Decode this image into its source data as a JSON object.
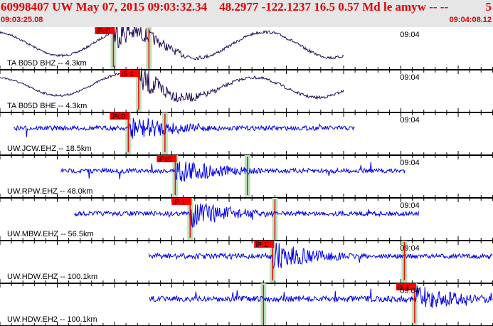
{
  "header": {
    "event": "60998407 UW May 07, 2015 09:03:32.34    48.2977 -122.1237 16.5 0.57 Md le amyw -- --",
    "count": "5",
    "start_time": "09:03:25.08",
    "end_time": "09:04:08.12"
  },
  "window_seconds": 43.04,
  "minute_label": "09:04",
  "minute_time_s": 34.92,
  "colors": {
    "text": "#e00000",
    "pick": "#ff0000",
    "band": "#b9e3bd",
    "trace_broadband": "#220a55",
    "trace_sp": "#0000ee"
  },
  "traces": [
    {
      "label": "TA B05D BHZ -- 4.3km",
      "color": "broadband",
      "span_s": [
        0,
        30
      ],
      "onset_s": 9.9,
      "amp": 1,
      "picks": [
        {
          "label": "iPc0",
          "t": 9.9
        },
        {
          "label": "",
          "t": 13.0
        }
      ]
    },
    {
      "label": "TA B05D BHE -- 4.3km",
      "color": "broadband",
      "span_s": [
        0,
        30
      ],
      "onset_s": 12.1,
      "amp": 1,
      "picks": [
        {
          "label": "iS 1",
          "t": 12.1
        }
      ]
    },
    {
      "label": "UW.JCW.EHZ -- 18.5km",
      "color": "sp",
      "span_s": [
        1.2,
        31
      ],
      "onset_s": 11.2,
      "amp": 1,
      "picks": [
        {
          "label": "iPc0",
          "t": 11.2
        },
        {
          "label": "",
          "t": 14.4
        }
      ]
    },
    {
      "label": "UW.RPW.EHZ -- 48.0km",
      "color": "sp",
      "span_s": [
        5.3,
        35.4
      ],
      "onset_s": 15.3,
      "amp": 1,
      "picks": [
        {
          "label": "iPc0",
          "t": 15.3
        },
        {
          "label": "",
          "t": 21.6
        }
      ]
    },
    {
      "label": "UW.MBW.EHZ -- 56.5km",
      "color": "sp",
      "span_s": [
        6.5,
        36.6
      ],
      "onset_s": 16.6,
      "amp": 1,
      "picks": [
        {
          "label": "iP 1",
          "t": 16.6
        },
        {
          "label": "",
          "t": 24.0
        }
      ]
    },
    {
      "label": "UW.HDW.EHZ -- 100.1km",
      "color": "sp",
      "span_s": [
        13,
        43.04
      ],
      "onset_s": 23.8,
      "amp": 1,
      "picks": [
        {
          "label": "iP 1",
          "t": 23.8
        },
        {
          "label": "",
          "t": 35.3
        }
      ]
    },
    {
      "label": "UW.HDW.EH2 -- 100.1km",
      "color": "sp",
      "span_s": [
        13,
        43.04
      ],
      "onset_s": 36.2,
      "amp": 1,
      "picks": [
        {
          "label": "",
          "t": 23.0
        },
        {
          "label": "iS 1",
          "t": 36.2
        }
      ]
    }
  ]
}
